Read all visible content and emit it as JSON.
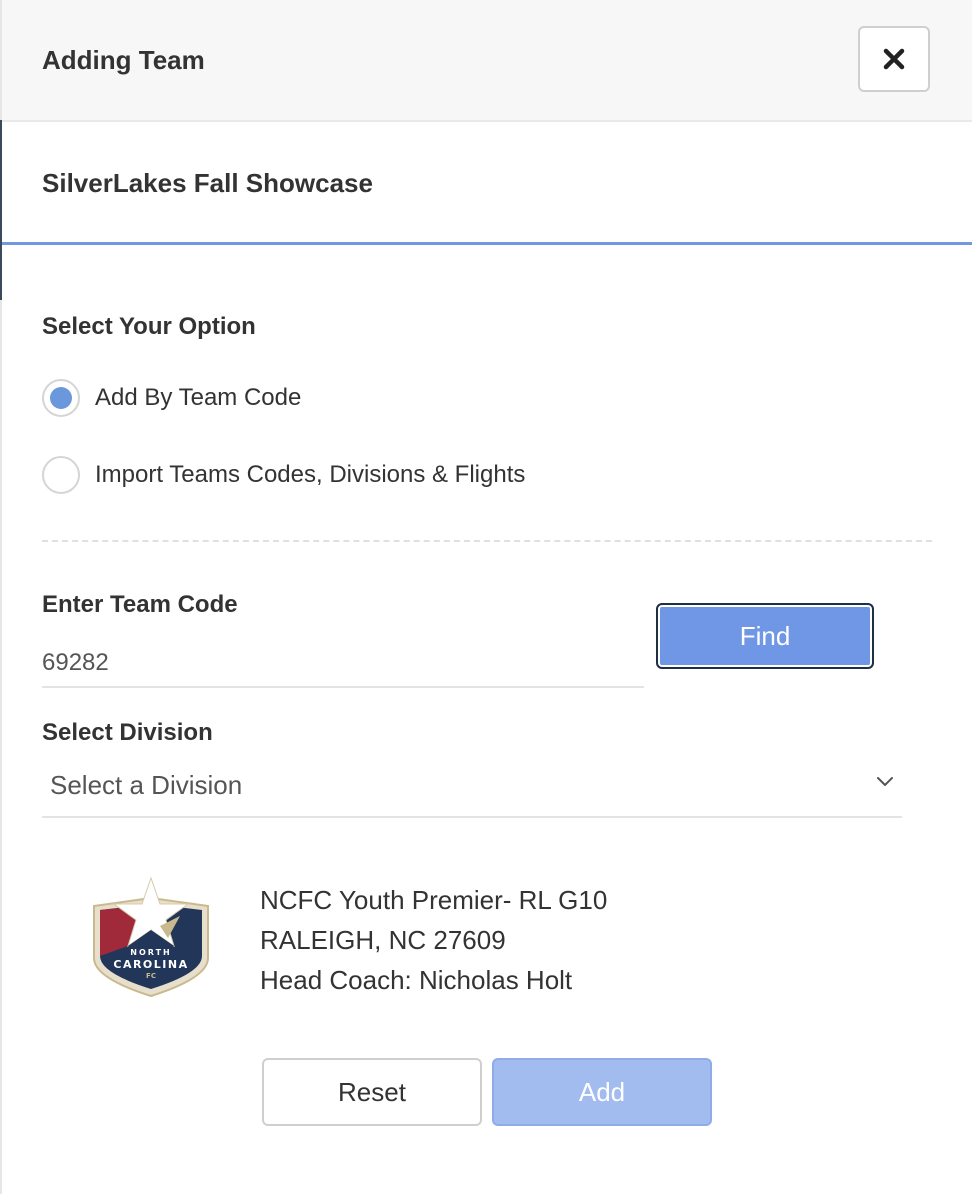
{
  "modal": {
    "title": "Adding Team",
    "event_name": "SilverLakes Fall Showcase"
  },
  "options": {
    "label": "Select Your Option",
    "items": [
      {
        "label": "Add By Team Code",
        "checked": true
      },
      {
        "label": "Import Teams Codes, Divisions & Flights",
        "checked": false
      }
    ]
  },
  "team_code": {
    "label": "Enter Team Code",
    "value": "69282",
    "find_label": "Find"
  },
  "division": {
    "label": "Select Division",
    "selected": "Select a Division"
  },
  "team": {
    "name": "NCFC Youth Premier- RL G10",
    "location": "RALEIGH, NC 27609",
    "coach": "Head Coach: Nicholas Holt",
    "logo": {
      "text_top": "NORTH",
      "text_main": "CAROLINA",
      "text_bottom": "FC"
    }
  },
  "actions": {
    "reset_label": "Reset",
    "add_label": "Add"
  },
  "colors": {
    "accent": "#6f97e6",
    "accent_disabled": "#a3bcf0",
    "radio_checked": "#6b97dc"
  }
}
